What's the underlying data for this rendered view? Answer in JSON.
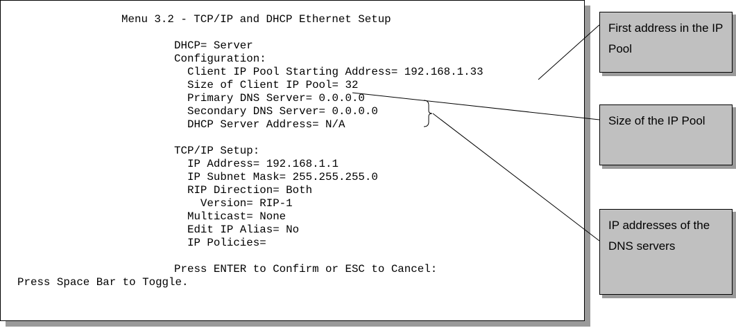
{
  "terminal": {
    "title": "Menu 3.2 - TCP/IP and DHCP Ethernet Setup",
    "lines": [
      "DHCP= Server",
      "Configuration:",
      "  Client IP Pool Starting Address= 192.168.1.33",
      "  Size of Client IP Pool= 32",
      "  Primary DNS Server= 0.0.0.0",
      "  Secondary DNS Server= 0.0.0.0",
      "  DHCP Server Address= N/A",
      "",
      "TCP/IP Setup:",
      "  IP Address= 192.168.1.1",
      "  IP Subnet Mask= 255.255.255.0",
      "  RIP Direction= Both",
      "    Version= RIP-1",
      "  Multicast= None",
      "  Edit IP Alias= No",
      "  IP Policies=",
      "",
      "Press ENTER to Confirm or ESC to Cancel:"
    ],
    "footer": "Press Space Bar to Toggle."
  },
  "callouts": {
    "first_address": "First address in the IP Pool",
    "pool_size": "Size of the IP Pool",
    "dns_servers": "IP addresses of the DNS servers"
  }
}
